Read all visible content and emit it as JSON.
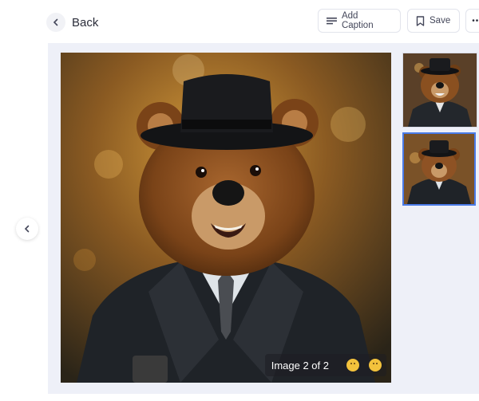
{
  "topbar": {
    "back_label": "Back",
    "add_caption_label": "Add Caption",
    "save_label": "Save",
    "more_label": "•••"
  },
  "viewer": {
    "main_image": "bear-in-bowler-hat-and-suit",
    "caption": "Image 2 of 2",
    "thumbnails": [
      "bear-in-suit-variant-1",
      "bear-in-suit-variant-2"
    ],
    "selected_index": 1
  },
  "icons": {
    "back": "chevron-left-icon",
    "add_caption": "caption-lines-icon",
    "save": "bookmark-icon",
    "more": "more-dots-icon",
    "prev": "chevron-left-icon",
    "reaction": "emoji-face-icon"
  },
  "colors": {
    "stage_background": "#eef0f8",
    "selected_border": "#4a7be8"
  }
}
